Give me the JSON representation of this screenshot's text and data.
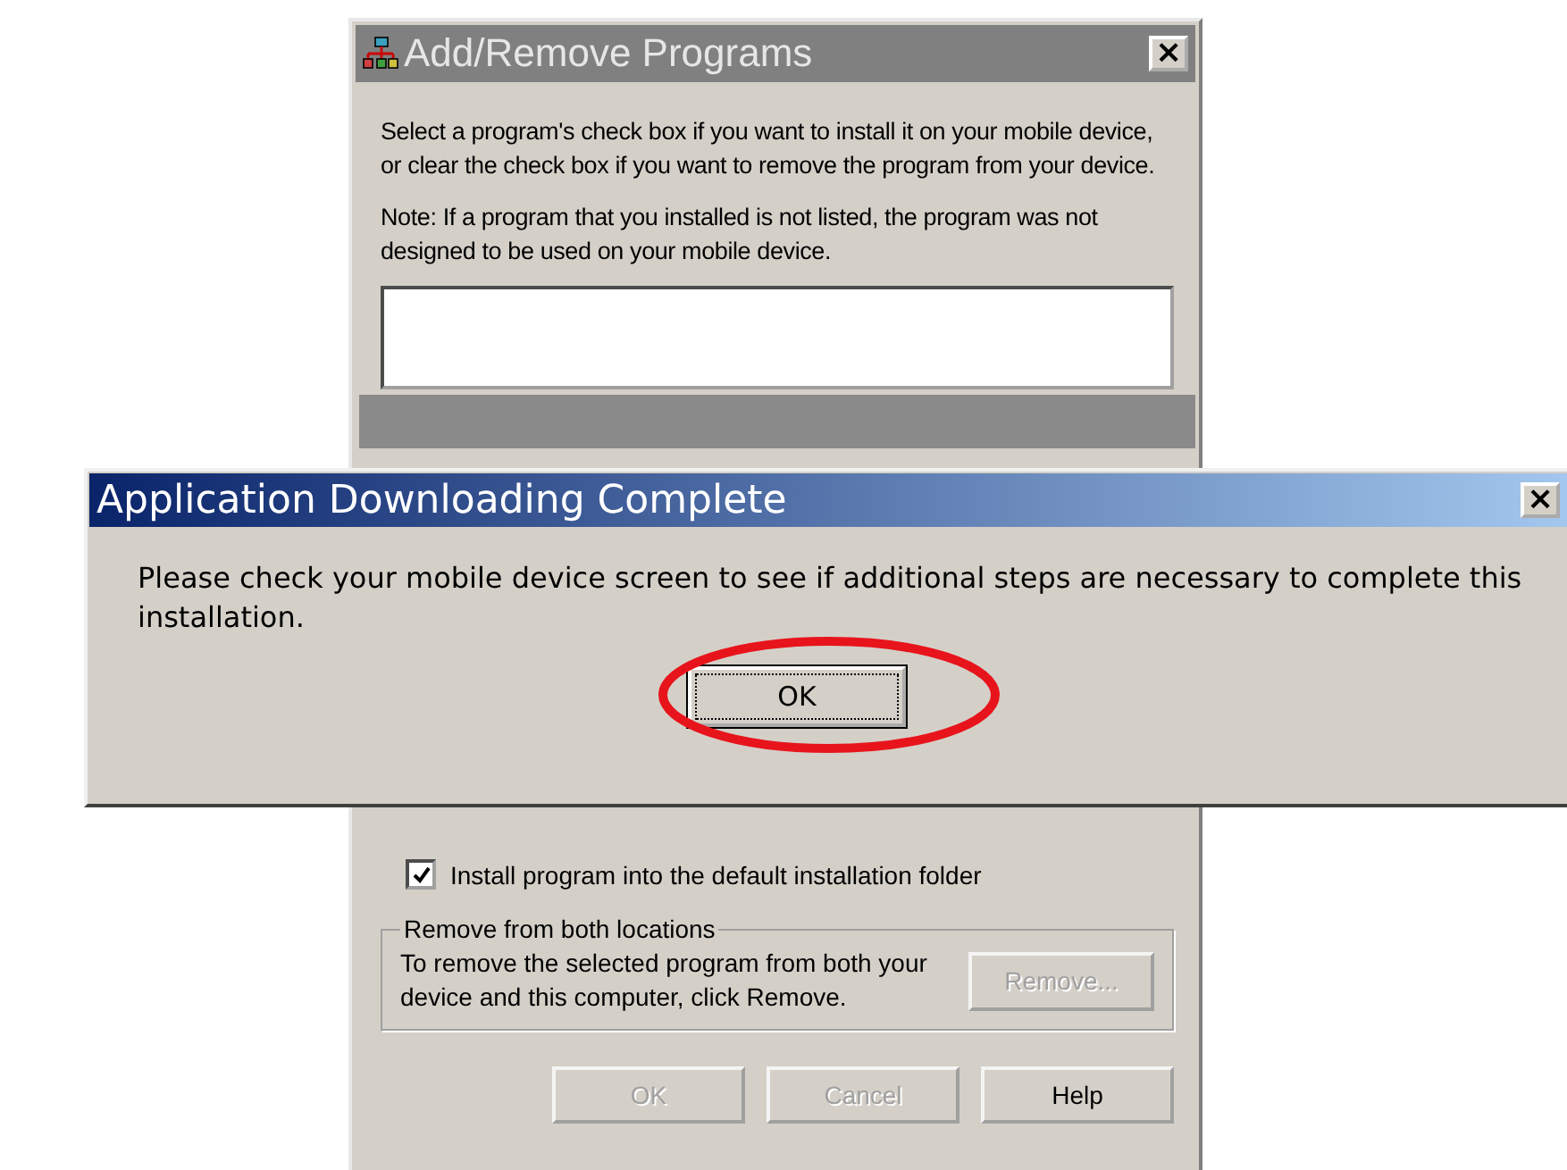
{
  "back_window": {
    "title": "Add/Remove Programs",
    "close": "×",
    "intro": "Select a program's check box if you want to install it on your mobile device, or clear the check box if you want to remove the program from your device.",
    "note": "Note:  If a program that you installed is not listed, the program was not designed to be used on your mobile device.",
    "install_default": {
      "label": "Install program into the default installation folder",
      "checked": true
    },
    "group": {
      "title": "Remove from both locations",
      "text": "To remove the selected program from both your device and this computer, click Remove.",
      "button": {
        "label": "Remove...",
        "disabled": true
      }
    },
    "buttons": [
      {
        "label": "OK",
        "disabled": true
      },
      {
        "label": "Cancel",
        "disabled": true
      },
      {
        "label": "Help",
        "disabled": false
      }
    ]
  },
  "dialog": {
    "title": "Application Downloading Complete",
    "close": "×",
    "message": "Please check your mobile device screen to see if additional steps are necessary to complete this installation.",
    "button": "OK",
    "highlighted": true
  }
}
